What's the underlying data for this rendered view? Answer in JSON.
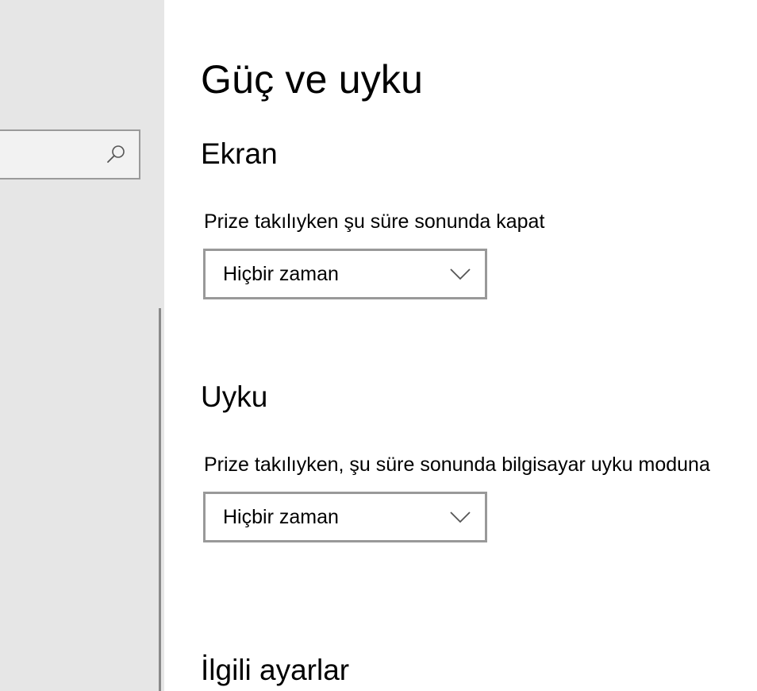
{
  "sidebar": {
    "search": {
      "placeholder": "",
      "icon": "search-icon"
    }
  },
  "main": {
    "title": "Güç ve uyku",
    "screen": {
      "heading": "Ekran",
      "plugged_in_label": "Prize takılıyken şu süre sonunda kapat",
      "plugged_in_value": "Hiçbir zaman"
    },
    "sleep": {
      "heading": "Uyku",
      "plugged_in_label": "Prize takılıyken, şu süre sonunda bilgisayar uyku moduna",
      "plugged_in_value": "Hiçbir zaman"
    },
    "related": {
      "heading": "İlgili ayarlar"
    }
  },
  "colors": {
    "sidebar_bg": "#e6e6e6",
    "border": "#999999",
    "text": "#000000"
  }
}
